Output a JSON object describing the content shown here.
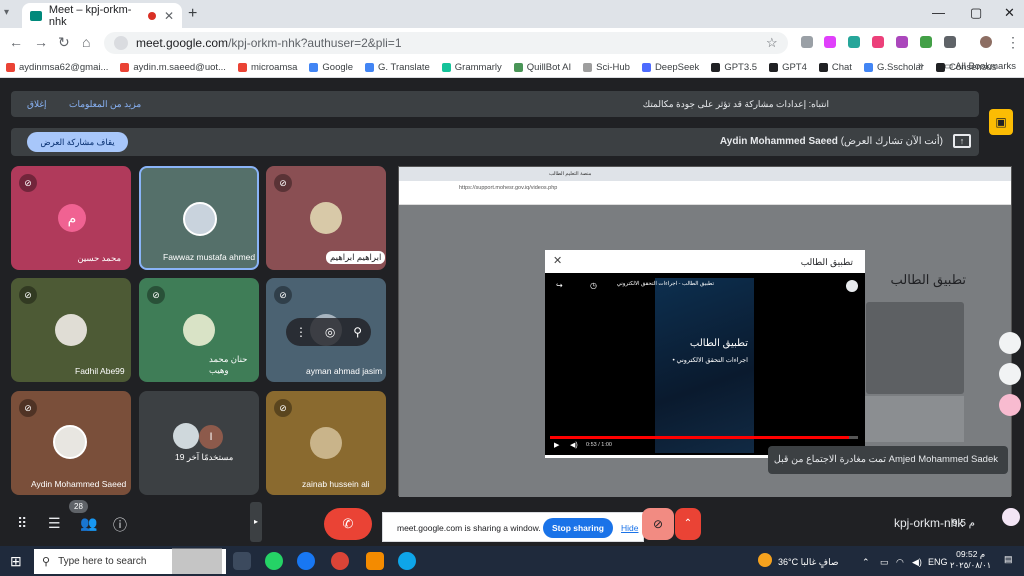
{
  "browser": {
    "tab_title": "Meet – kpj-orkm-nhk",
    "new_tab": "+",
    "url_host": "meet.google.com",
    "url_path": "/kpj-orkm-nhk?authuser=2&pli=1",
    "window_minimize": "—",
    "window_maximize": "▢",
    "window_close": "✕",
    "bookmarks": [
      {
        "label": "aydinmsa62@gmai...",
        "color": "#ea4335"
      },
      {
        "label": "aydin.m.saeed@uot...",
        "color": "#ea4335"
      },
      {
        "label": "microamsa",
        "color": "#ea4335"
      },
      {
        "label": "Google",
        "color": "#4285f4"
      },
      {
        "label": "G. Translate",
        "color": "#4285f4"
      },
      {
        "label": "Grammarly",
        "color": "#15c39a"
      },
      {
        "label": "QuillBot AI",
        "color": "#499557"
      },
      {
        "label": "Sci-Hub",
        "color": "#9e9e9e"
      },
      {
        "label": "DeepSeek",
        "color": "#4d6bfe"
      },
      {
        "label": "GPT3.5",
        "color": "#202124"
      },
      {
        "label": "GPT4",
        "color": "#202124"
      },
      {
        "label": "Chat",
        "color": "#202124"
      },
      {
        "label": "G.Sscholar",
        "color": "#4285f4"
      },
      {
        "label": "Consensus",
        "color": "#202124"
      }
    ],
    "bookmarks_more": "»",
    "all_bookmarks": "All Bookmarks"
  },
  "meet": {
    "notice_text": "انتباه: إعدادات مشاركة قد تؤثر على جودة مكالمتك",
    "notice_more": "مزيد من المعلومات",
    "notice_close": "إغلاق",
    "presenting_name": "Aydin Mohammed Saeed",
    "presenting_suffix": " (أنت الآن تشارك العرض)",
    "stop_presenting": "يقاف مشاركة العرض",
    "participants": [
      {
        "name": "محمد حسين",
        "letter": "م"
      },
      {
        "name": "Fawwaz mustafa ahmed"
      },
      {
        "name": "ابراهيم ابراهيم"
      },
      {
        "name": "Fadhil Abe99"
      },
      {
        "name": "حنان محمد وهيب"
      },
      {
        "name": "ayman ahmad jasim"
      },
      {
        "name": "Aydin Mohammed Saeed"
      },
      {
        "name": "19 مستخدمًا آخر",
        "letter": "I"
      },
      {
        "name": "zainab hussein ali"
      }
    ],
    "participant_count": "28",
    "meeting_code": "kpj-orkm-nhk",
    "meeting_time": "9:5 م",
    "toast": "تمت مغادرة الاجتماع من قبل Amjed Mohammed Sadek",
    "sharing_notice": "meet.google.com is sharing a window.",
    "stop_sharing": "Stop sharing",
    "hide": "Hide"
  },
  "shared_screen": {
    "inner_tab": "منصة التعليم الطالب",
    "inner_url": "https://support.mohesr.gov.iq/videos.php",
    "page_heading": "تطبيق الطالب",
    "modal_title": "تطبيق الطالب",
    "video_title": "تطبيق الطالب - اجراءات التحقق الالكتروني",
    "poster_title": "تطبيق الطالب",
    "poster_subtitle": "• اجراءات التحقق الالكتروني",
    "video_time": "0:53 / 1:00",
    "progress": 0.97
  },
  "taskbar": {
    "search_placeholder": "Type here to search",
    "weather": "36°C صافٍ غالبا",
    "language": "ENG",
    "time": "09:52 م",
    "date": "٢٠٢٥/٠٨/٠١"
  }
}
